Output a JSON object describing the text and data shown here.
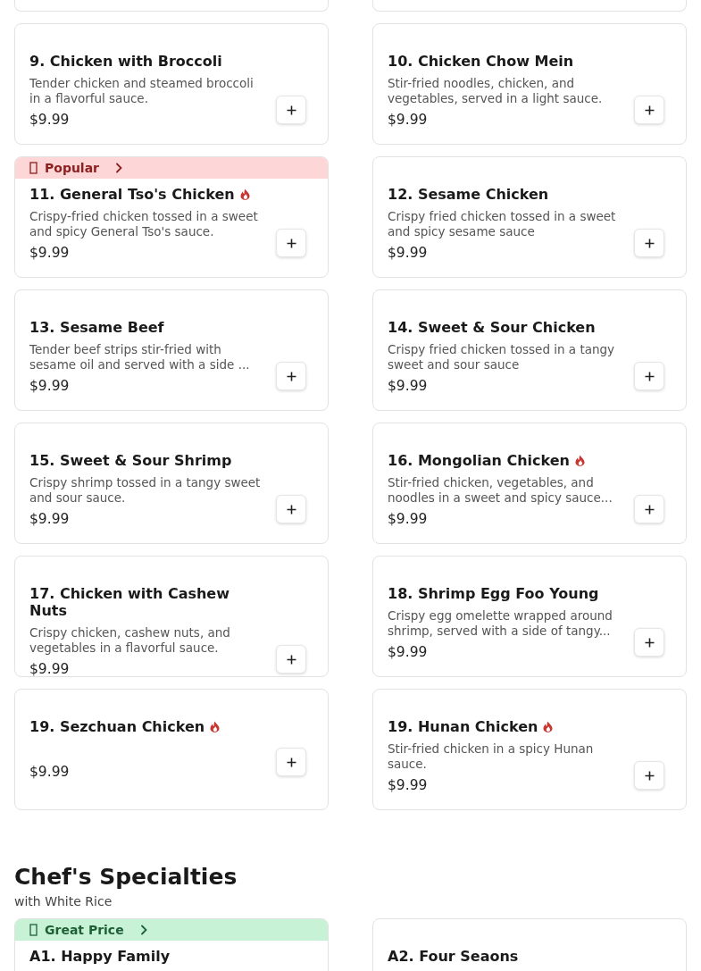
{
  "sections": [
    {
      "items": [
        {
          "name": "9. Chicken with Broccoli",
          "description": "Tender chicken and steamed broccoli in a flavorful sauce.",
          "price": "$9.99",
          "spicy": false
        },
        {
          "name": "10. Chicken Chow Mein",
          "description": "Stir-fried noodles, chicken, and vegetables, served in a light sauce.",
          "price": "$9.99",
          "spicy": false
        },
        {
          "badge": {
            "kind": "popular",
            "label": "Popular"
          },
          "name": "11. General Tso's Chicken",
          "description": "Crispy-fried chicken tossed in a sweet and spicy General Tso's sauce.",
          "price": "$9.99",
          "spicy": true
        },
        {
          "name": "12. Sesame Chicken",
          "description": "Crispy fried chicken tossed in a sweet and spicy sesame sauce",
          "price": "$9.99",
          "spicy": false
        },
        {
          "name": "13. Sesame Beef",
          "description": "Tender beef strips stir-fried with sesame oil and served with a side ...",
          "price": "$9.99",
          "spicy": false
        },
        {
          "name": "14. Sweet & Sour Chicken",
          "description": "Crispy fried chicken tossed in a tangy sweet and sour sauce",
          "price": "$9.99",
          "spicy": false
        },
        {
          "name": "15. Sweet & Sour Shrimp",
          "description": "Crispy shrimp tossed in a tangy sweet and sour sauce.",
          "price": "$9.99",
          "spicy": false
        },
        {
          "name": "16. Mongolian Chicken",
          "description": "Stir-fried chicken, vegetables, and noodles in a sweet and spicy sauce...",
          "price": "$9.99",
          "spicy": true
        },
        {
          "name": "17. Chicken with Cashew Nuts",
          "description": "Crispy chicken, cashew nuts, and vegetables in a flavorful sauce.",
          "price": "$9.99",
          "spicy": false
        },
        {
          "name": "18. Shrimp Egg Foo Young",
          "description": "Crispy egg omelette wrapped around shrimp, served with a side of tangy...",
          "price": "$9.99",
          "spicy": false
        },
        {
          "name": "19. Sezchuan Chicken",
          "price": "$9.99",
          "spicy": true
        },
        {
          "name": "19. Hunan Chicken",
          "description": "Stir-fried chicken in a spicy Hunan sauce.",
          "price": "$9.99",
          "spicy": true
        }
      ]
    },
    {
      "title": "Chef's Specialties",
      "subtitle": "with White Rice",
      "items": [
        {
          "badge": {
            "kind": "deal",
            "label": "Great Price"
          },
          "name": "A1. Happy Family",
          "spicy": false
        },
        {
          "name": "A2. Four Seaons",
          "spicy": false
        }
      ]
    }
  ]
}
